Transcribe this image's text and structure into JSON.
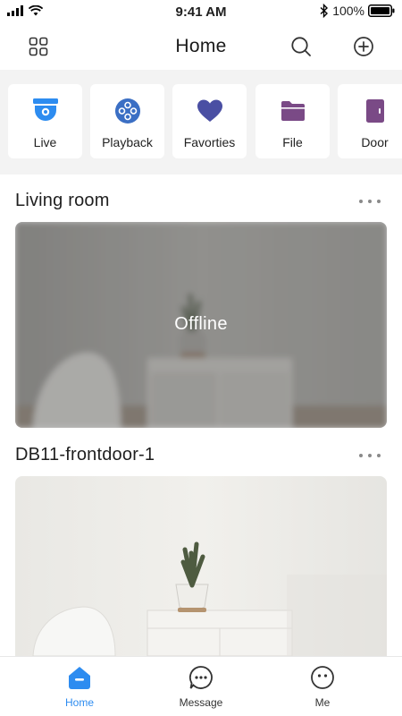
{
  "status_bar": {
    "time": "9:41 AM",
    "battery": "100%",
    "icons": [
      "signal-icon",
      "wifi-icon",
      "bluetooth-icon",
      "battery-icon"
    ]
  },
  "header": {
    "title": "Home",
    "left_icon": "grid-menu-icon",
    "right_icons": [
      "search-icon",
      "add-circle-icon"
    ]
  },
  "quick_access": [
    {
      "label": "Live",
      "icon": "camera-icon",
      "color": "#2d8cf0"
    },
    {
      "label": "Playback",
      "icon": "playback-reel-icon",
      "color": "#3b6fc4"
    },
    {
      "label": "Favorties",
      "icon": "heart-icon",
      "color": "#4a4fa3"
    },
    {
      "label": "File",
      "icon": "folder-icon",
      "color": "#7a4a86"
    },
    {
      "label": "Door",
      "icon": "door-icon",
      "color": "#7a4a86"
    }
  ],
  "devices": [
    {
      "name": "Living room",
      "status": "Offline",
      "more_icon": "more-dots-icon"
    },
    {
      "name": "DB11-frontdoor-1",
      "status": "",
      "more_icon": "more-dots-icon"
    }
  ],
  "tab_bar": [
    {
      "label": "Home",
      "icon": "home-icon",
      "active": true
    },
    {
      "label": "Message",
      "icon": "message-icon",
      "active": false
    },
    {
      "label": "Me",
      "icon": "profile-icon",
      "active": false
    }
  ],
  "colors": {
    "accent": "#2d8cf0",
    "background": "#ffffff",
    "quick_bar_bg": "#f3f3f3"
  }
}
